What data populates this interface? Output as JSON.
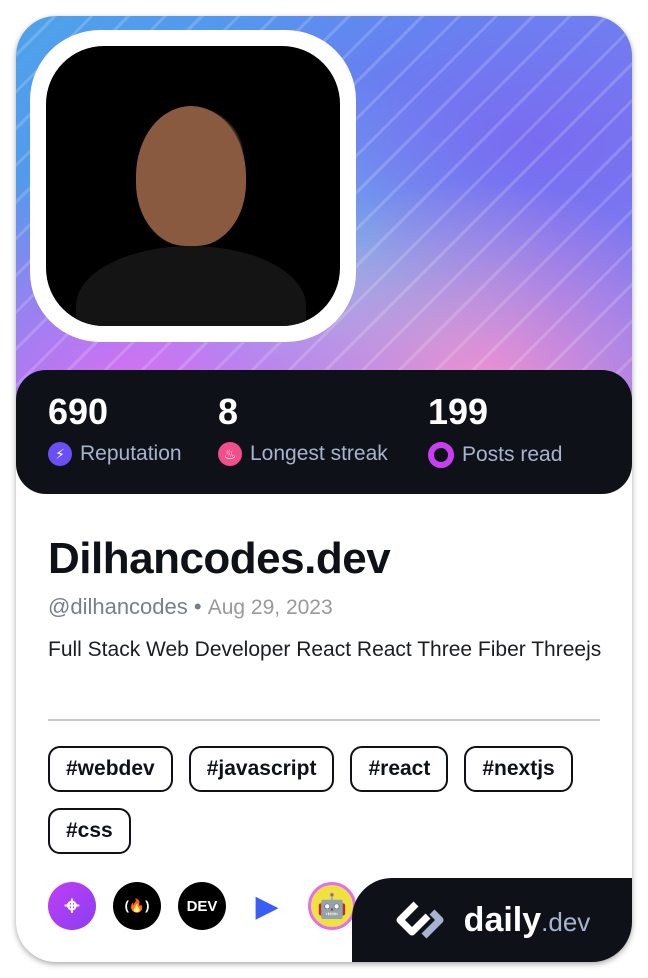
{
  "stats": [
    {
      "value": "690",
      "label": "Reputation",
      "icon": "lightning-icon",
      "color": "#6a4ff5"
    },
    {
      "value": "8",
      "label": "Longest streak",
      "icon": "flame-icon",
      "color": "#f24e8c"
    },
    {
      "value": "199",
      "label": "Posts read",
      "icon": "ring-icon",
      "color": "#c93ef0"
    }
  ],
  "profile": {
    "name": "Dilhancodes.dev",
    "username": "@dilhancodes",
    "separator": "•",
    "joined": "Aug 29, 2023",
    "bio": "Full Stack Web Developer React React Three Fiber Threejs"
  },
  "tags": [
    "#webdev",
    "#javascript",
    "#react",
    "#nextjs",
    "#css"
  ],
  "sources": [
    {
      "icon": "crosshair-source-icon",
      "text": "⌖",
      "color": "#a73ef0"
    },
    {
      "icon": "freecodecamp-source-icon",
      "text": "(🔥)",
      "color": "#000000"
    },
    {
      "icon": "dev-to-source-icon",
      "text": "DEV",
      "color": "#000000"
    },
    {
      "icon": "arrow-source-icon",
      "text": "▶",
      "color": "#3b5cf5"
    },
    {
      "icon": "robot-source-icon",
      "text": "🤖",
      "color": "#f0e040"
    }
  ],
  "brand": {
    "name": "daily",
    "suffix": ".dev"
  }
}
